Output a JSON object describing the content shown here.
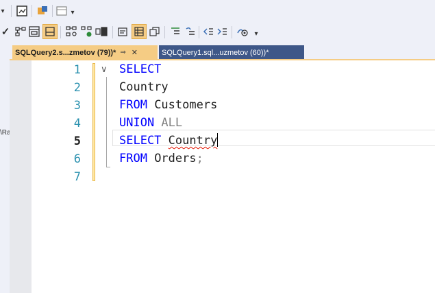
{
  "tabs": [
    {
      "label": "SQLQuery2.s...zmetov (79))*",
      "pin": "⇒",
      "close": "✕"
    },
    {
      "label": "SQLQuery1.sql...uzmetov (60))*"
    }
  ],
  "left_panel": {
    "fragment": "\\Ra",
    "close": "×"
  },
  "editor": {
    "line_numbers": [
      "1",
      "2",
      "3",
      "4",
      "5",
      "6",
      "7"
    ],
    "current_line": "5",
    "lines": [
      {
        "kw": "SELECT",
        "rest": ""
      },
      {
        "kw": "",
        "rest": "Country"
      },
      {
        "kw": "FROM",
        "rest": " Customers"
      },
      {
        "kw": "UNION",
        "gray": " ALL"
      },
      {
        "kw": "SELECT",
        "sp": " ",
        "err": "Country"
      },
      {
        "kw": "FROM",
        "rest": " Orders",
        "gray": ";"
      }
    ]
  },
  "toolbar": {
    "icons": [
      "dropdown-arrow-icon",
      "results-to-file-icon",
      "parse-icon",
      "overflow-icon",
      "execute-check-icon",
      "display-plan-icon",
      "results-to-grid-icon",
      "include-stats-icon",
      "include-plan-icon",
      "show-results-icon",
      "indent-icon",
      "results-to-text-icon",
      "results-to-file2-icon",
      "comment-icon",
      "uncomment-icon",
      "decrease-indent-icon",
      "increase-indent-icon",
      "specify-values-icon"
    ]
  }
}
